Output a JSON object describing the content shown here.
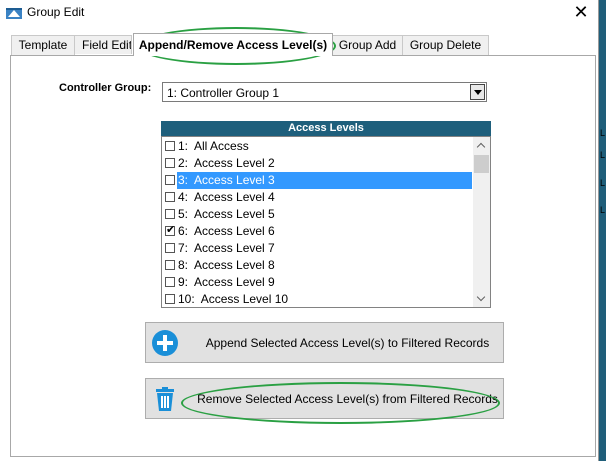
{
  "window": {
    "title": "Group Edit",
    "close_glyph": "✕"
  },
  "tabs": [
    {
      "label": "Template"
    },
    {
      "label": "Field Edit"
    },
    {
      "label": "Append/Remove Access Level(s)"
    },
    {
      "label": "Group Add"
    },
    {
      "label": "Group Delete"
    }
  ],
  "controller_group": {
    "label": "Controller Group:",
    "value": "1:  Controller Group 1"
  },
  "access_levels": {
    "header": "Access Levels",
    "items": [
      {
        "text": "1:  All Access",
        "checked": false,
        "selected": false
      },
      {
        "text": "2:  Access Level 2",
        "checked": false,
        "selected": false
      },
      {
        "text": "3:  Access Level 3",
        "checked": false,
        "selected": true
      },
      {
        "text": "4:  Access Level 4",
        "checked": false,
        "selected": false
      },
      {
        "text": "5:  Access Level 5",
        "checked": false,
        "selected": false
      },
      {
        "text": "6:  Access Level 6",
        "checked": true,
        "selected": false
      },
      {
        "text": "7:  Access Level 7",
        "checked": false,
        "selected": false
      },
      {
        "text": "8:  Access Level 8",
        "checked": false,
        "selected": false
      },
      {
        "text": "9:  Access Level 9",
        "checked": false,
        "selected": false
      },
      {
        "text": "10:  Access Level 10",
        "checked": false,
        "selected": false
      }
    ]
  },
  "buttons": {
    "append": {
      "label": "Append Selected Access Level(s) to Filtered Records",
      "icon": "plus-circle-icon"
    },
    "remove": {
      "label": "Remove Selected Access Level(s) from Filtered Records",
      "icon": "trash-icon"
    }
  },
  "colors": {
    "list_header": "#1e5f7c",
    "selection": "#3399ff",
    "annotation": "#2aa043",
    "append_icon": "#1a8fd8",
    "remove_icon": "#1a8fd8"
  }
}
